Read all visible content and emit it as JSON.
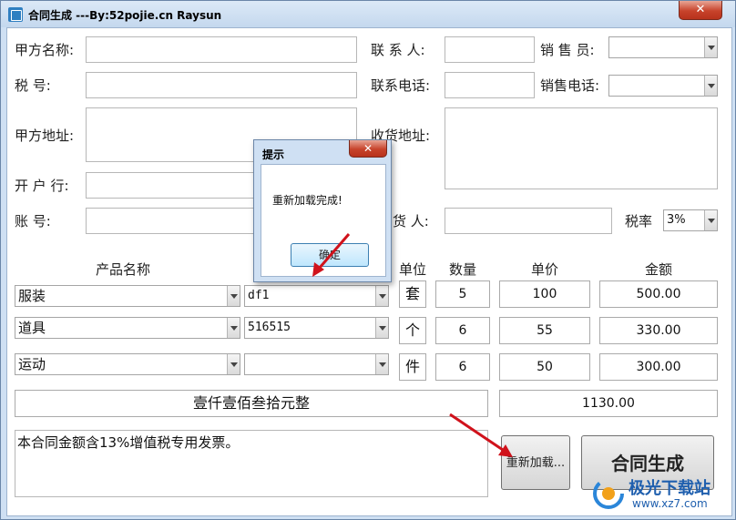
{
  "window": {
    "title": "合同生成 ---By:52pojie.cn Raysun",
    "close_glyph": "✕"
  },
  "form": {
    "party_a_name_label": "甲方名称:",
    "tax_no_label": "税      号:",
    "party_a_address_label": "甲方地址:",
    "bank_label": "开 户 行:",
    "account_label": "账      号:",
    "contact_label": "联 系 人:",
    "contact_phone_label": "联系电话:",
    "shipping_address_label": "收货地址:",
    "receiver_label": "货 人:",
    "salesperson_label": "销 售 员:",
    "sales_phone_label": "销售电话:",
    "tax_rate_label": "税率",
    "tax_rate_value": "3%"
  },
  "table": {
    "headers": {
      "product": "产品名称",
      "unit": "单位",
      "qty": "数量",
      "price": "单价",
      "amount": "金额"
    },
    "rows": [
      {
        "product": "服装",
        "spec": "df1",
        "unit": "套",
        "qty": "5",
        "price": "100",
        "amount": "500.00"
      },
      {
        "product": "道具",
        "spec": "516515",
        "unit": "个",
        "qty": "6",
        "price": "55",
        "amount": "330.00"
      },
      {
        "product": "运动",
        "spec": "",
        "unit": "件",
        "qty": "6",
        "price": "50",
        "amount": "300.00"
      }
    ],
    "total_in_words": "壹仟壹佰叁拾元整",
    "total": "1130.00"
  },
  "note": "本合同金额含13%增值税专用发票。",
  "buttons": {
    "reload": "重新加载...",
    "generate": "合同生成"
  },
  "dialog": {
    "title": "提示",
    "message": "重新加载完成!",
    "ok": "确定",
    "close_glyph": "✕"
  },
  "watermark": {
    "brand": "极光下载站",
    "url": "www.xz7.com"
  },
  "colors": {
    "title_bar": "#c4d8ee",
    "close_red": "#c7432b",
    "arrow_red": "#d0121b"
  }
}
